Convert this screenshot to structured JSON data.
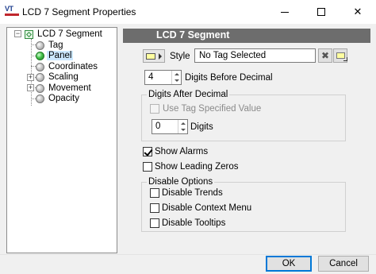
{
  "window": {
    "title": "LCD 7 Segment Properties",
    "logo_text": "VT",
    "controls": {
      "minimize": "",
      "maximize": "",
      "close": "✕"
    }
  },
  "tree": {
    "root": {
      "label": "LCD 7 Segment",
      "expander": "⊟"
    },
    "items": [
      {
        "label": "Tag",
        "icon": "gray-ball-icon",
        "expander": ""
      },
      {
        "label": "Panel",
        "icon": "green-ball-icon",
        "expander": "",
        "selected": true
      },
      {
        "label": "Coordinates",
        "icon": "gray-ball-icon",
        "expander": ""
      },
      {
        "label": "Scaling",
        "icon": "gray-ball-icon",
        "expander": "+"
      },
      {
        "label": "Movement",
        "icon": "gray-ball-icon",
        "expander": "+"
      },
      {
        "label": "Opacity",
        "icon": "gray-ball-icon",
        "expander": ""
      }
    ]
  },
  "panel": {
    "header": "LCD 7 Segment",
    "style_label": "Style",
    "tag_value": "No Tag Selected",
    "clear_symbol": "✖",
    "digits_before": {
      "value": "4",
      "label": "Digits Before Decimal"
    },
    "digits_after_group": {
      "title": "Digits After Decimal",
      "use_tag_label": "Use Tag Specified Value",
      "use_tag_checked": false,
      "digits_value": "0",
      "digits_label": "Digits"
    },
    "show_alarms": {
      "label": "Show Alarms",
      "checked": true
    },
    "show_leading_zeros": {
      "label": "Show Leading Zeros",
      "checked": false
    },
    "disable_group": {
      "title": "Disable Options",
      "items": [
        {
          "label": "Disable Trends",
          "checked": false
        },
        {
          "label": "Disable Context Menu",
          "checked": false
        },
        {
          "label": "Disable Tooltips",
          "checked": false
        }
      ]
    }
  },
  "footer": {
    "ok_label": "OK",
    "cancel_label": "Cancel"
  },
  "colors": {
    "header_bg": "#6d6d6d",
    "selection": "#cce8ff",
    "default_button_border": "#0078d7"
  }
}
